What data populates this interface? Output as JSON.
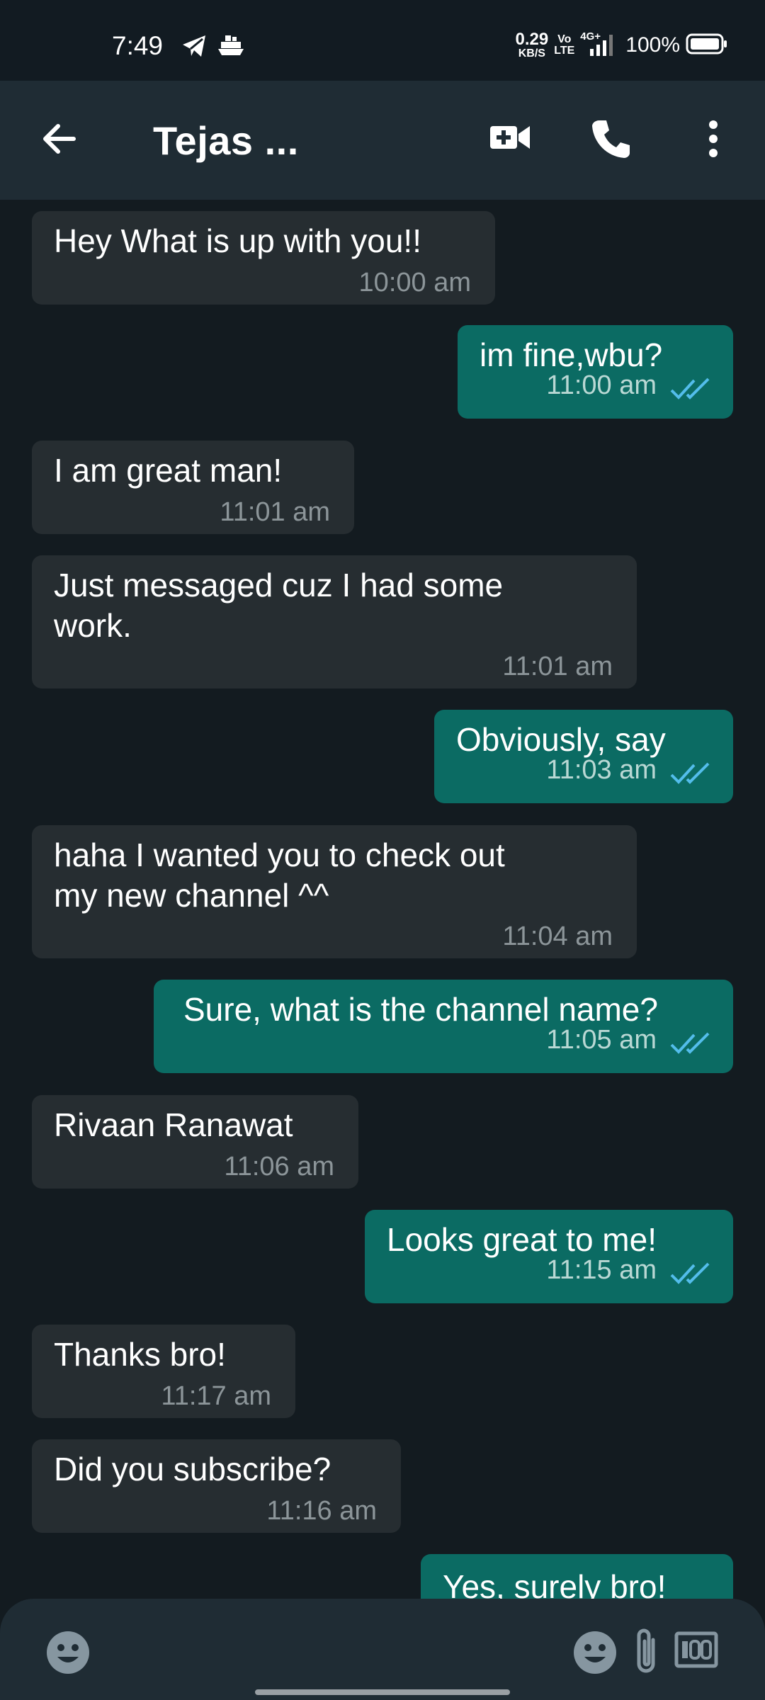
{
  "status_bar": {
    "time": "7:49",
    "net_speed_value": "0.29",
    "net_speed_unit": "KB/S",
    "volte_top": "Vo",
    "volte_bottom": "LTE",
    "network": "4G+",
    "battery": "100%",
    "icons": [
      "telegram-icon",
      "ship-icon",
      "signal-icon",
      "battery-icon"
    ]
  },
  "app_bar": {
    "title": "Tejas ...",
    "icons": [
      "back-arrow-icon",
      "video-call-icon",
      "phone-icon",
      "more-vert-icon"
    ]
  },
  "colors": {
    "background": "#131b20",
    "incoming_bubble": "#262d31",
    "outgoing_bubble": "#0b6b63",
    "read_ticks": "#53bdeb"
  },
  "messages": [
    {
      "direction": "in",
      "text": "Hey What is up with you!!",
      "time": "10:00 am"
    },
    {
      "direction": "out",
      "text": "im fine,wbu?",
      "time": "11:00 am",
      "status": "read"
    },
    {
      "direction": "in",
      "text": "I am great man!",
      "time": "11:01 am"
    },
    {
      "direction": "in",
      "text_line1": "Just messaged cuz I had some",
      "text_line2": "work.",
      "time": "11:01 am"
    },
    {
      "direction": "out",
      "text": "Obviously, say",
      "time": "11:03 am",
      "status": "read"
    },
    {
      "direction": "in",
      "text_line1": "haha I wanted you to check out",
      "text_line2": "my new channel ^^",
      "time": "11:04 am"
    },
    {
      "direction": "out",
      "text": "Sure, what is the channel name?",
      "time": "11:05 am",
      "status": "read"
    },
    {
      "direction": "in",
      "text": "Rivaan Ranawat",
      "time": "11:06 am"
    },
    {
      "direction": "out",
      "text": "Looks great to me!",
      "time": "11:15 am",
      "status": "read"
    },
    {
      "direction": "in",
      "text": "Thanks bro!",
      "time": "11:17 am"
    },
    {
      "direction": "in",
      "text": "Did you subscribe?",
      "time": "11:16 am"
    },
    {
      "direction": "out",
      "text": "Yes, surely bro!",
      "time": "",
      "status": "read"
    }
  ],
  "composer": {
    "icons": [
      "emoji-icon",
      "emoji-icon",
      "attach-icon",
      "keyboard-icon"
    ]
  }
}
